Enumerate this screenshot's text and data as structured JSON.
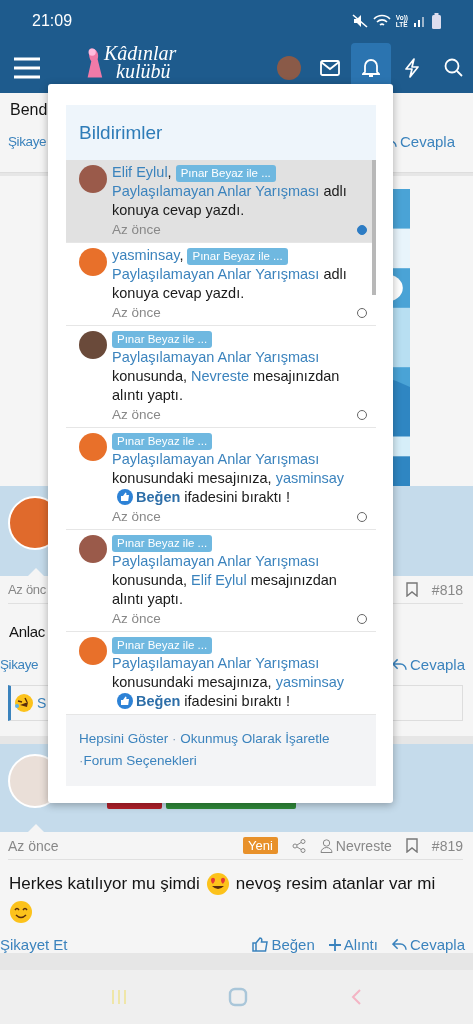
{
  "status_bar": {
    "time": "21:09",
    "network": [
      "Vo))",
      "LTE"
    ]
  },
  "header": {
    "logo": [
      "Kâdınlar",
      "kulübü"
    ],
    "icons": [
      {
        "kind": "avatar",
        "selected": false
      },
      {
        "kind": "mail",
        "selected": false
      },
      {
        "kind": "bell",
        "selected": true
      },
      {
        "kind": "bolt",
        "selected": false
      },
      {
        "kind": "search",
        "selected": false
      }
    ]
  },
  "top_post": {
    "text": "Bend",
    "report": "Şikaye",
    "reply": "Cevapla"
  },
  "posts": [
    {
      "color": "#e06a2c",
      "time": "Az önc",
      "number": "#818",
      "body": [
        {
          "kind": "text",
          "text": "Anlac"
        }
      ],
      "report": "Şikaye",
      "reply": "Cevapla",
      "reaction": [
        {
          "kind": "rofl"
        },
        {
          "kind": "text",
          "text": "S"
        }
      ]
    },
    {
      "color": "#eadfd8",
      "banners": [
        {
          "color": "#b3202a"
        },
        {
          "color": "#2f8a3a"
        }
      ],
      "time": "Az önce",
      "badge": "Yeni",
      "author": "Nevreste",
      "number": "#819",
      "body": [
        {
          "kind": "text",
          "text": "Herkes katılıyor mu şimdi"
        },
        {
          "kind": "hearteyes"
        },
        {
          "kind": "text",
          "text": "nevoş resim atanlar var mi"
        },
        {
          "kind": "smile"
        }
      ],
      "report": "Şikayet Et",
      "like": "Beğen",
      "quote": "Alıntı",
      "reply": "Cevapla"
    }
  ],
  "popup": {
    "title": "Bildirimler",
    "items": [
      {
        "color": "#9a5a4a",
        "unread": true,
        "time": "Az önce",
        "parts": [
          {
            "kind": "link",
            "text": "Elif Eylul"
          },
          {
            "kind": "text",
            "text": ", "
          },
          {
            "kind": "tag",
            "text": "Pınar Beyaz ile ..."
          },
          {
            "kind": "link",
            "text": "Paylaşılamayan Anlar Yarışması"
          },
          {
            "kind": "text",
            "text": " adlı konuya cevap yazdı."
          }
        ]
      },
      {
        "color": "#e8702a",
        "unread": false,
        "time": "Az önce",
        "parts": [
          {
            "kind": "link",
            "text": "yasminsay"
          },
          {
            "kind": "text",
            "text": ", "
          },
          {
            "kind": "tag",
            "text": "Pınar Beyaz ile ..."
          },
          {
            "kind": "link",
            "text": "Paylaşılamayan Anlar Yarışması"
          },
          {
            "kind": "text",
            "text": " adlı konuya cevap yazdı."
          }
        ]
      },
      {
        "color": "#6a4a3a",
        "unread": false,
        "time": "Az önce",
        "parts": [
          {
            "kind": "tag",
            "text": "Pınar Beyaz ile ..."
          },
          {
            "kind": "link",
            "text": "Paylaşılamayan Anlar Yarışması"
          },
          {
            "kind": "text",
            "text": " konusunda, "
          },
          {
            "kind": "link",
            "text": "Nevreste"
          },
          {
            "kind": "text",
            "text": " mesajınızdan alıntı yaptı."
          }
        ]
      },
      {
        "color": "#e8702a",
        "unread": false,
        "time": "Az önce",
        "parts": [
          {
            "kind": "tag",
            "text": "Pınar Beyaz ile ..."
          },
          {
            "kind": "link",
            "text": "Paylaşılamayan Anlar Yarışması"
          },
          {
            "kind": "text",
            "text": " konusundaki mesajınıza, "
          },
          {
            "kind": "link",
            "text": "yasminsay"
          },
          {
            "kind": "reaction",
            "text": "Beğen"
          },
          {
            "kind": "text",
            "text": " ifadesini bıraktı !"
          }
        ]
      },
      {
        "color": "#9a5a4a",
        "unread": false,
        "time": "Az önce",
        "parts": [
          {
            "kind": "tag",
            "text": "Pınar Beyaz ile ..."
          },
          {
            "kind": "link",
            "text": "Paylaşılamayan Anlar Yarışması"
          },
          {
            "kind": "text",
            "text": " konusunda, "
          },
          {
            "kind": "link",
            "text": "Elif Eylul"
          },
          {
            "kind": "text",
            "text": " mesajınızdan alıntı yaptı."
          }
        ]
      },
      {
        "color": "#e8702a",
        "unread": false,
        "parts": [
          {
            "kind": "tag",
            "text": "Pınar Beyaz ile ..."
          },
          {
            "kind": "link",
            "text": "Paylaşılamayan Anlar Yarışması"
          },
          {
            "kind": "text",
            "text": " konusundaki mesajınıza, "
          },
          {
            "kind": "link",
            "text": "yasminsay"
          },
          {
            "kind": "reaction",
            "text": "Beğen"
          },
          {
            "kind": "text",
            "text": " ifadesini bıraktı !"
          }
        ]
      }
    ],
    "footer": [
      {
        "kind": "link",
        "text": "Hepsini Göster"
      },
      {
        "kind": "sep",
        "text": " · "
      },
      {
        "kind": "link",
        "text": "Okunmuş Olarak İşaretle"
      },
      {
        "kind": "sep",
        "text": " ·"
      },
      {
        "kind": "link",
        "text": "Forum Seçenekleri"
      }
    ]
  }
}
